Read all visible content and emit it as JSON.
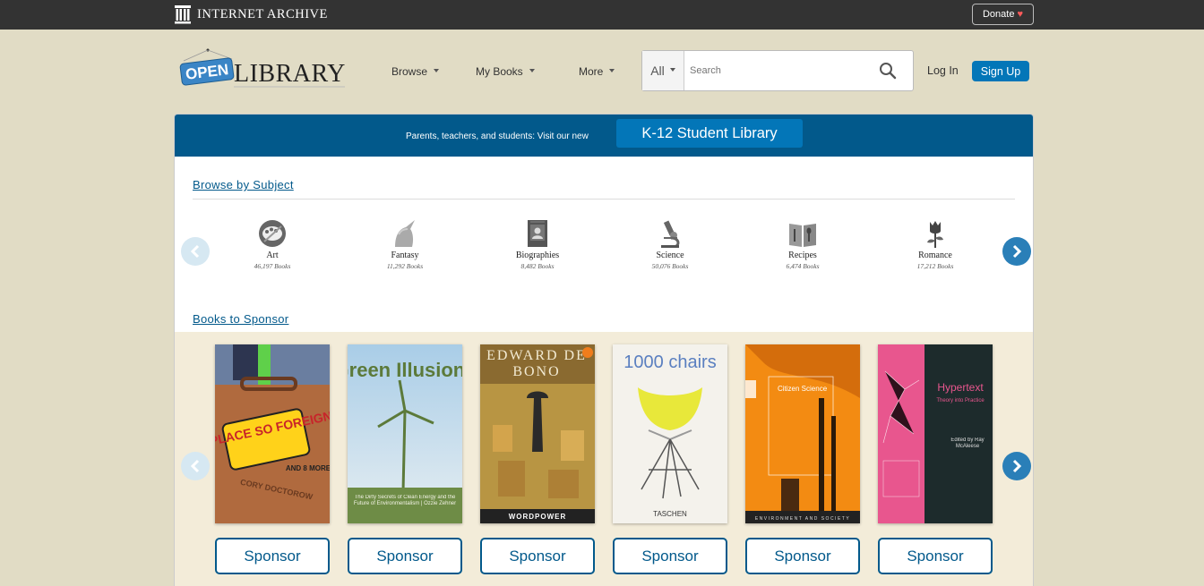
{
  "ia_bar": {
    "title": "INTERNET ARCHIVE",
    "donate_label": "Donate",
    "heart": "♥"
  },
  "header": {
    "logo_open": "OPEN",
    "logo_library": "LIBRARY",
    "nav": [
      {
        "label": "Browse"
      },
      {
        "label": "My Books"
      },
      {
        "label": "More"
      }
    ],
    "search": {
      "scope": "All",
      "placeholder": "Search"
    },
    "login_label": "Log In",
    "signup_label": "Sign Up"
  },
  "banner": {
    "text": "Parents, teachers, and students: Visit our new",
    "button_label": "K-12 Student Library"
  },
  "browse": {
    "heading": "Browse by Subject",
    "subjects": [
      {
        "name": "Art",
        "count": "46,197 Books",
        "icon": "palette-icon"
      },
      {
        "name": "Fantasy",
        "count": "11,292 Books",
        "icon": "unicorn-icon"
      },
      {
        "name": "Biographies",
        "count": "8,482 Books",
        "icon": "portrait-icon"
      },
      {
        "name": "Science",
        "count": "50,076 Books",
        "icon": "microscope-icon"
      },
      {
        "name": "Recipes",
        "count": "6,474 Books",
        "icon": "cookbook-icon"
      },
      {
        "name": "Romance",
        "count": "17,212 Books",
        "icon": "rose-icon"
      }
    ]
  },
  "sponsor": {
    "heading": "Books to Sponsor",
    "button_label": "Sponsor",
    "books": [
      {
        "cover_main": "A PLACE SO FOREIGN",
        "cover_sub": "AND 8 MORE",
        "author": "CORY DOCTOROW"
      },
      {
        "cover_main": "Green Illusions",
        "cover_sub": "The Dirty Secrets of Clean Energy and the Future of Environmentalism | Ozzie Zehner"
      },
      {
        "cover_main": "EDWARD DE BONO",
        "cover_sub": "WORDPOWER"
      },
      {
        "cover_main": "1000 chairs",
        "cover_sub": "TASCHEN"
      },
      {
        "cover_main": "Citizen Science",
        "cover_sub": "ENVIRONMENT AND SOCIETY"
      },
      {
        "cover_main": "Hypertext",
        "cover_sub": "Theory into Practice",
        "author": "Edited by Ray McAleese"
      }
    ]
  },
  "colors": {
    "brand_blue": "#02598b",
    "accent_blue": "#0376b8",
    "page_bg": "#e1dcc5"
  }
}
